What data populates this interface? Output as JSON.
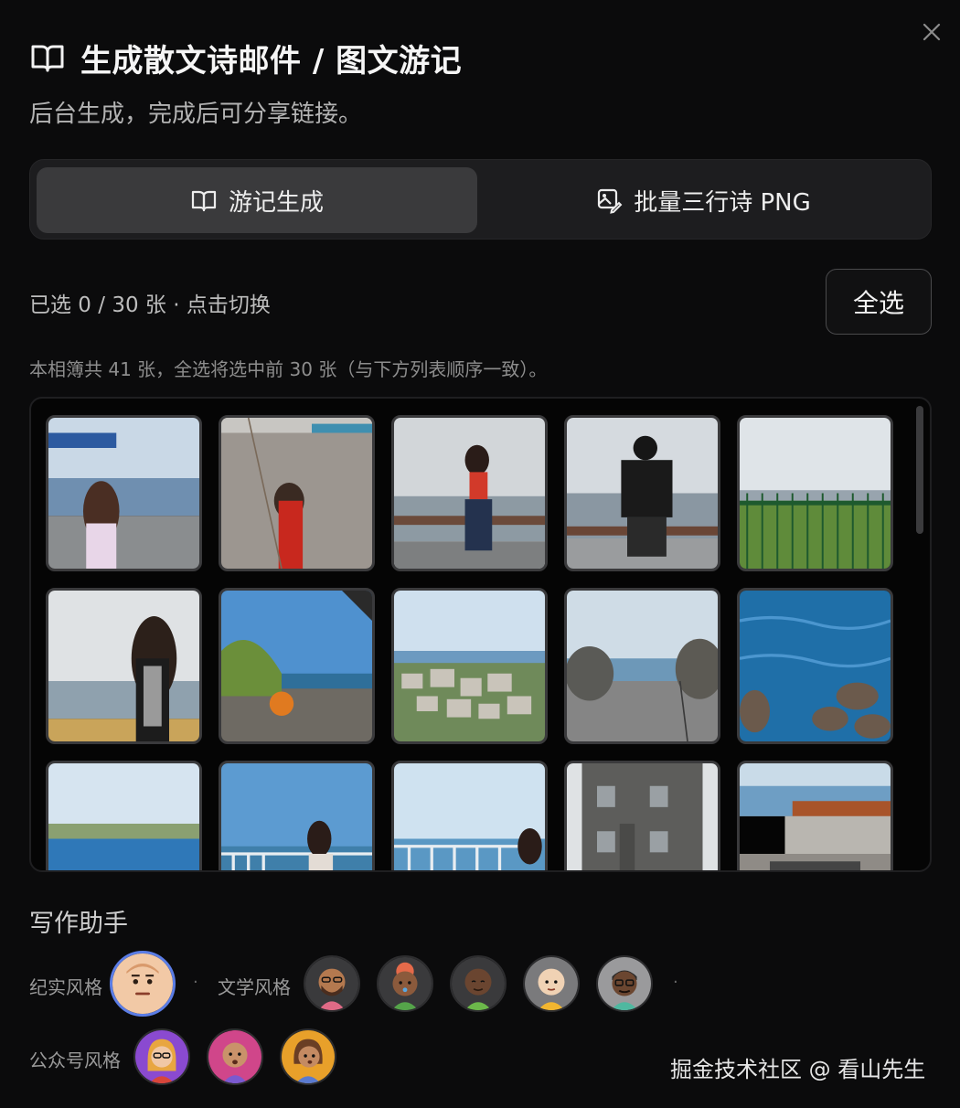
{
  "header": {
    "title": "生成散文诗邮件 / 图文游记",
    "subtitle": "后台生成，完成后可分享链接。"
  },
  "tabs": [
    {
      "label": "游记生成",
      "icon": "book-open-icon",
      "active": true
    },
    {
      "label": "批量三行诗 PNG",
      "icon": "image-pen-icon",
      "active": false
    }
  ],
  "selection": {
    "status": "已选 0 / 30 张 · 点击切换",
    "select_all_label": "全选",
    "note": "本相簿共 41 张，全选将选中前 30 张（与下方列表顺序一致）。"
  },
  "assistant": {
    "title": "写作助手",
    "documentary_label": "纪实风格",
    "literary_label": "文学风格",
    "wechat_label": "公众号风格"
  },
  "colors": {
    "background": "#0b0b0c",
    "panel": "#1d1d1f",
    "active_tab": "#3a3a3c",
    "selected_ring": "#5b7de6"
  },
  "watermark": "掘金技术社区 @ 看山先生"
}
